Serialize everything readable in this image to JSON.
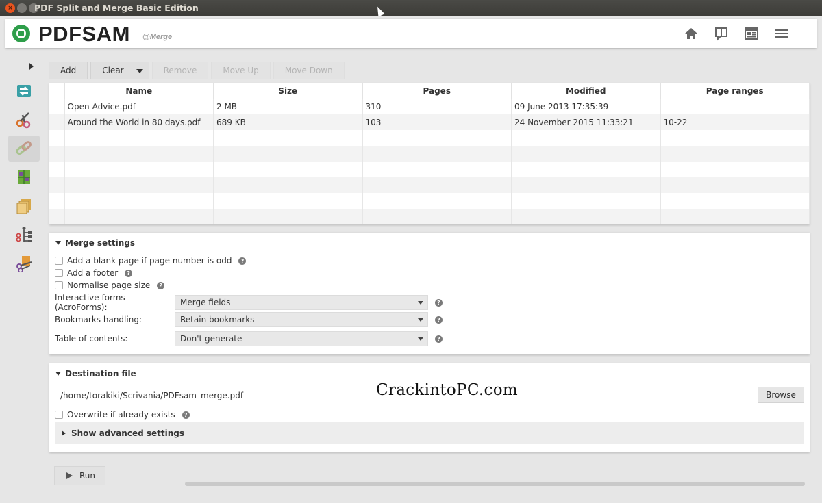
{
  "window": {
    "title": "PDF Split and Merge Basic Edition"
  },
  "header": {
    "brand": "PDFSAM",
    "subbrand": "@Merge",
    "icons": [
      "home-icon",
      "feedback-icon",
      "news-icon",
      "menu-icon"
    ]
  },
  "sidebar": {
    "tools": [
      "split-merge-icon",
      "split-icon",
      "merge-icon",
      "extract-pages-icon",
      "rotate-icon",
      "split-by-bookmarks-icon",
      "split-by-size-icon"
    ],
    "active": "merge-icon"
  },
  "toolbar": {
    "add": "Add",
    "clear": "Clear",
    "remove": "Remove",
    "move_up": "Move Up",
    "move_down": "Move Down"
  },
  "table": {
    "headers": [
      "Name",
      "Size",
      "Pages",
      "Modified",
      "Page ranges"
    ],
    "rows": [
      [
        "Open-Advice.pdf",
        "2 MB",
        "310",
        "09 June 2013 17:35:39",
        ""
      ],
      [
        "Around the World in 80 days.pdf",
        "689 KB",
        "103",
        "24 November 2015 11:33:21",
        "10-22"
      ]
    ]
  },
  "merge_settings": {
    "title": "Merge settings",
    "blank_page": "Add a blank page if page number is odd",
    "footer": "Add a footer",
    "normalise": "Normalise page size",
    "forms_label": "Interactive forms (AcroForms):",
    "forms_value": "Merge fields",
    "bookmarks_label": "Bookmarks handling:",
    "bookmarks_value": "Retain bookmarks",
    "toc_label": "Table of contents:",
    "toc_value": "Don't generate"
  },
  "destination": {
    "title": "Destination file",
    "path": "/home/torakiki/Scrivania/PDFsam_merge.pdf",
    "browse": "Browse",
    "overwrite": "Overwrite if already exists",
    "advanced": "Show advanced settings"
  },
  "watermark": "CrackintoPC.com",
  "run": {
    "label": "Run"
  },
  "help_glyph": "?"
}
